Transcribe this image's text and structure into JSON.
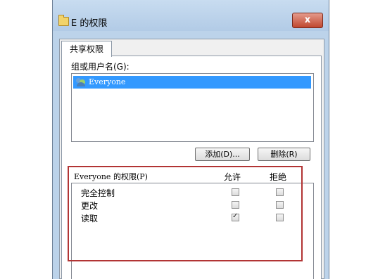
{
  "window": {
    "title": "E 的权限",
    "close_label": "x"
  },
  "tabs": [
    {
      "label": "共享权限"
    }
  ],
  "group": {
    "label": "组或用户名(G):",
    "items": [
      {
        "name": "Everyone",
        "selected": true
      }
    ]
  },
  "buttons": {
    "add_label": "添加(D)...",
    "remove_label": "删除(R)"
  },
  "permissions": {
    "header": "Everyone 的权限(P)",
    "allow_label": "允许",
    "deny_label": "拒绝",
    "rows": [
      {
        "label": "完全控制",
        "allow": false,
        "deny": false
      },
      {
        "label": "更改",
        "allow": false,
        "deny": false
      },
      {
        "label": "读取",
        "allow": true,
        "deny": false
      }
    ]
  },
  "colors": {
    "selection": "#3399ff",
    "annotation": "#b23434",
    "titlebar": "#bcd3ea"
  }
}
